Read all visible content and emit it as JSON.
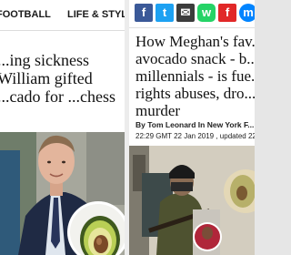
{
  "left": {
    "nav": {
      "football": "FOOTBALL",
      "life_style": "LIFE & STYLE"
    },
    "headline": "...ing sickness William gifted ...cado for ...chess"
  },
  "right": {
    "share": {
      "facebook": "f",
      "twitter": "t",
      "email": "✉",
      "whatsapp": "w",
      "flipboard": "f",
      "messenger": "m"
    },
    "headline": "How Meghan's fav... avocado snack - b... millennials - is fue... rights abuses, dro... murder",
    "byline": "By Tom Leonard In New York F...",
    "dateline": "22:29 GMT 22 Jan 2019 , updated 22..."
  },
  "colors": {
    "facebook": "#3b5998",
    "twitter": "#1da1f2",
    "email": "#3c3c3c",
    "whatsapp": "#25d366",
    "flipboard": "#e12828",
    "messenger": "#0084ff"
  },
  "icons": {
    "facebook": "facebook-icon",
    "twitter": "twitter-icon",
    "email": "email-icon",
    "whatsapp": "whatsapp-icon",
    "flipboard": "flipboard-icon",
    "messenger": "messenger-icon"
  }
}
